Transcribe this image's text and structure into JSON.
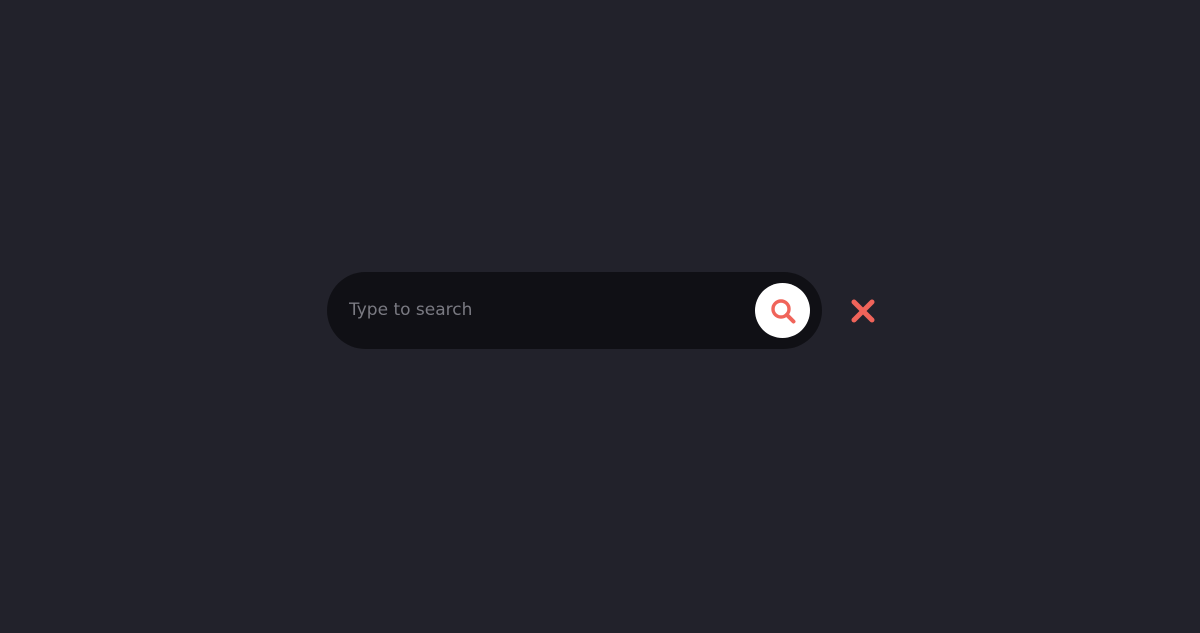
{
  "search": {
    "placeholder": "Type to search",
    "value": "",
    "search_icon": "search-icon",
    "clear_icon": "close-icon"
  },
  "colors": {
    "page_background": "#22222b",
    "search_bar_background": "#101015",
    "search_button_background": "#ffffff",
    "accent": "#f0645a",
    "placeholder": "#7a7a82"
  }
}
